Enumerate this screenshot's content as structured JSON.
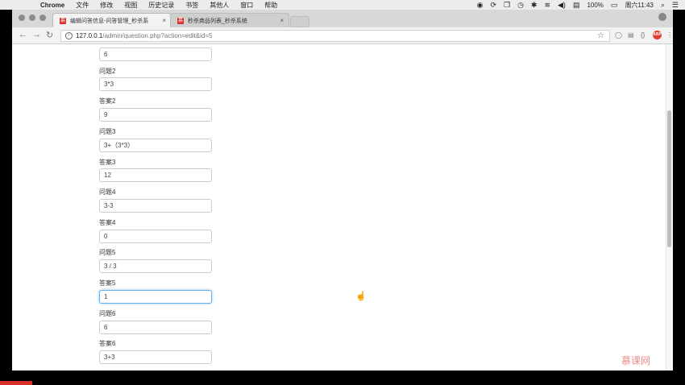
{
  "menubar": {
    "app": "Chrome",
    "items": [
      "文件",
      "修改",
      "视图",
      "历史记录",
      "书签",
      "其他人",
      "窗口",
      "帮助"
    ],
    "battery": "100%",
    "clock": "周六11:43"
  },
  "tabs": [
    {
      "title": "编辑问答信息-问答管理_秒杀系"
    },
    {
      "title": "秒杀商品列表_秒杀系统"
    }
  ],
  "address": {
    "host": "127.0.0.1",
    "path": "/admin/question.php?action=edit&id=5"
  },
  "extensions": {
    "abp": "ABP"
  },
  "form": {
    "first_value": "6",
    "rows": [
      {
        "label": "问题2",
        "value": "3*3"
      },
      {
        "label": "答案2",
        "value": "9"
      },
      {
        "label": "问题3",
        "value": "3+（3*3）"
      },
      {
        "label": "答案3",
        "value": "12"
      },
      {
        "label": "问题4",
        "value": "3-3"
      },
      {
        "label": "答案4",
        "value": "0"
      },
      {
        "label": "问题5",
        "value": "3 / 3"
      },
      {
        "label": "答案5",
        "value": "1"
      },
      {
        "label": "问题6",
        "value": "6"
      },
      {
        "label": "答案6",
        "value": "3+3"
      }
    ]
  },
  "watermark": "慕课网",
  "colors": {
    "focus": "#66afe9",
    "brand": "#d9302c"
  }
}
